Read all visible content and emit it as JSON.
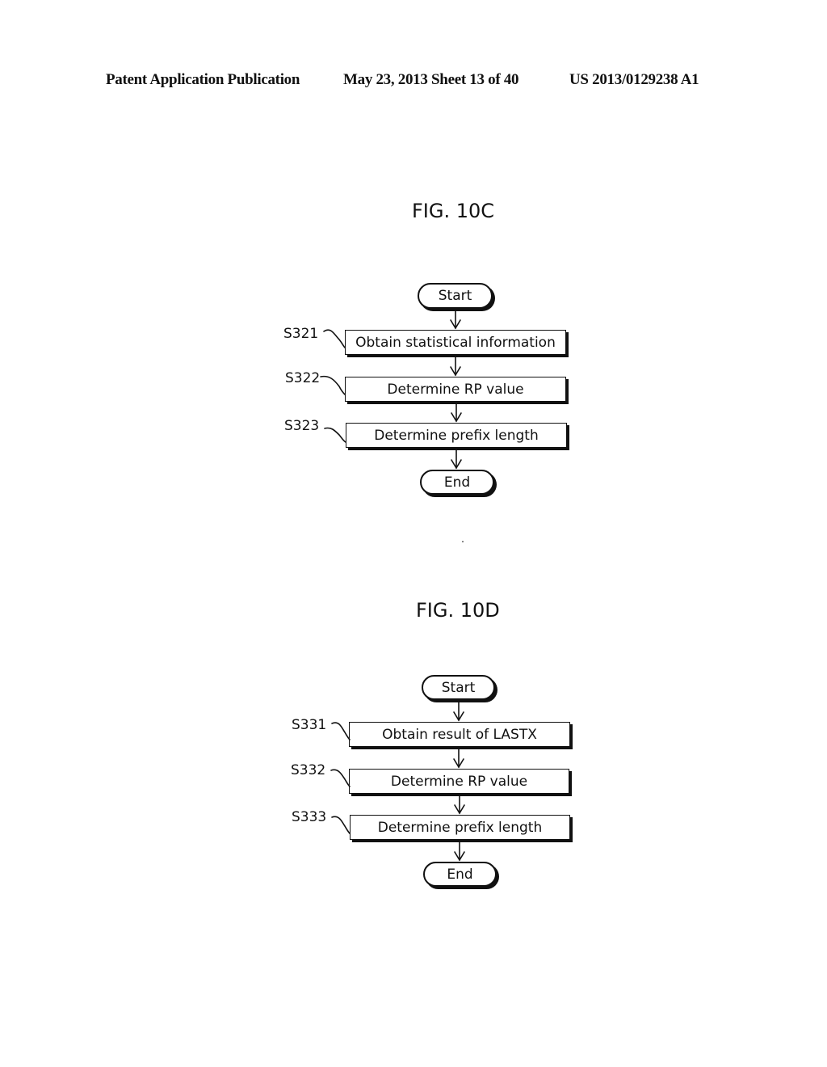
{
  "header": {
    "left": "Patent Application Publication",
    "date_sheet": "May 23, 2013  Sheet 13 of 40",
    "number": "US 2013/0129238 A1"
  },
  "figures": [
    {
      "title": "FIG. 10C",
      "start": "Start",
      "end": "End",
      "steps": [
        {
          "label": "S321",
          "text": "Obtain statistical information"
        },
        {
          "label": "S322",
          "text": "Determine RP value"
        },
        {
          "label": "S323",
          "text": "Determine prefix length"
        }
      ]
    },
    {
      "title": "FIG. 10D",
      "start": "Start",
      "end": "End",
      "steps": [
        {
          "label": "S331",
          "text": "Obtain result of LASTX"
        },
        {
          "label": "S332",
          "text": "Determine RP value"
        },
        {
          "label": "S333",
          "text": "Determine prefix length"
        }
      ]
    }
  ],
  "colors": {
    "ink": "#111111",
    "paper": "#ffffff"
  }
}
